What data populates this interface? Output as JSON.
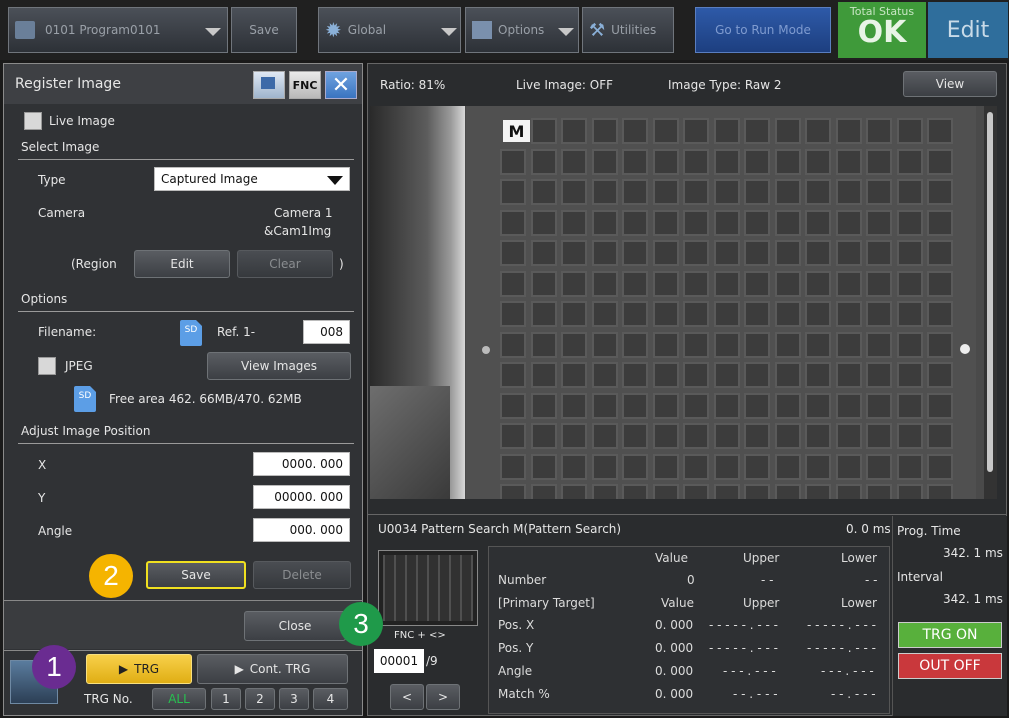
{
  "topbar": {
    "program": "0101  Program0101",
    "save": "Save",
    "global": "Global",
    "options": "Options",
    "utilities": "Utilities",
    "run_mode": "Go  to  Run  Mode",
    "total_status_label": "Total Status",
    "total_status_value": "OK",
    "edit": "Edit"
  },
  "dialog": {
    "title": "Register  Image",
    "fnc": "FNC",
    "live_image": "Live  Image",
    "select_image": "Select  Image",
    "type_label": "Type",
    "type_value": "Captured  Image",
    "camera_label": "Camera",
    "camera_value_1": "Camera  1",
    "camera_value_2": "&Cam1Img",
    "region_open": "(Region",
    "region_close": ")",
    "edit": "Edit",
    "clear": "Clear",
    "options": "Options",
    "filename_label": "Filename:",
    "sd_label": "SD",
    "ref_label": "Ref.  1-",
    "ref_value": "008",
    "jpeg_label": "JPEG",
    "view_images": "View  Images",
    "free_area": "Free  area  462. 66MB/470. 62MB",
    "adjust_title": "Adjust  Image  Position",
    "x_label": "X",
    "x_value": "0000. 000",
    "y_label": "Y",
    "y_value": "00000. 000",
    "angle_label": "Angle",
    "angle_value": "000. 000",
    "save": "Save",
    "delete": "Delete",
    "close": "Close",
    "trg": "TRG",
    "cont_trg": "Cont. TRG",
    "trg_no": "TRG  No.",
    "trg_all": "ALL",
    "trg_nums": [
      "1",
      "2",
      "3",
      "4"
    ]
  },
  "annotations": {
    "a1": "1",
    "a2": "2",
    "a3": "3"
  },
  "image_view": {
    "ratio": "Ratio:  81%",
    "live": "Live  Image:  OFF",
    "image_type": "Image  Type:  Raw  2",
    "view": "View",
    "marker": "M"
  },
  "results": {
    "tool": "U0034  Pattern  Search  M(Pattern  Search)",
    "time": "0. 0 ms",
    "fnc": "FNC  +  <>",
    "counter": "00001",
    "counter_total": "/9",
    "headers": [
      "Value",
      "Upper",
      "Lower"
    ],
    "number_label": "Number",
    "number_value": "0",
    "number_upper": "- -",
    "number_lower": "- -",
    "primary_label": "[Primary  Target]",
    "rows": [
      {
        "label": "Pos.  X",
        "value": "0. 000",
        "upper": "- - - - - . - - -",
        "lower": "- - - - - . - - -"
      },
      {
        "label": "Pos.  Y",
        "value": "0. 000",
        "upper": "- - - - - . - - -",
        "lower": "- - - - - . - - -"
      },
      {
        "label": "Angle",
        "value": "0. 000",
        "upper": "- - - . - - -",
        "lower": "- - - . - - -"
      },
      {
        "label": "Match  %",
        "value": "0. 000",
        "upper": "- - . - - -",
        "lower": "- - . - - -"
      }
    ],
    "prev": "<",
    "next": ">"
  },
  "timing": {
    "prog_time_label": "Prog.  Time",
    "prog_time_value": "342. 1 ms",
    "interval_label": "Interval",
    "interval_value": "342. 1 ms",
    "trg_on": "TRG ON",
    "out_off": "OUT OFF"
  },
  "colors": {
    "ok_green": "#3f9a3a",
    "edit_blue": "#2f6e9c",
    "trg_yellow": "#f0c020",
    "trg_on_green": "#58b03c",
    "out_off_red": "#c9383c",
    "annotation_purple": "#6a2c91",
    "annotation_yellow": "#f5b400",
    "annotation_green": "#1f9a4a"
  }
}
